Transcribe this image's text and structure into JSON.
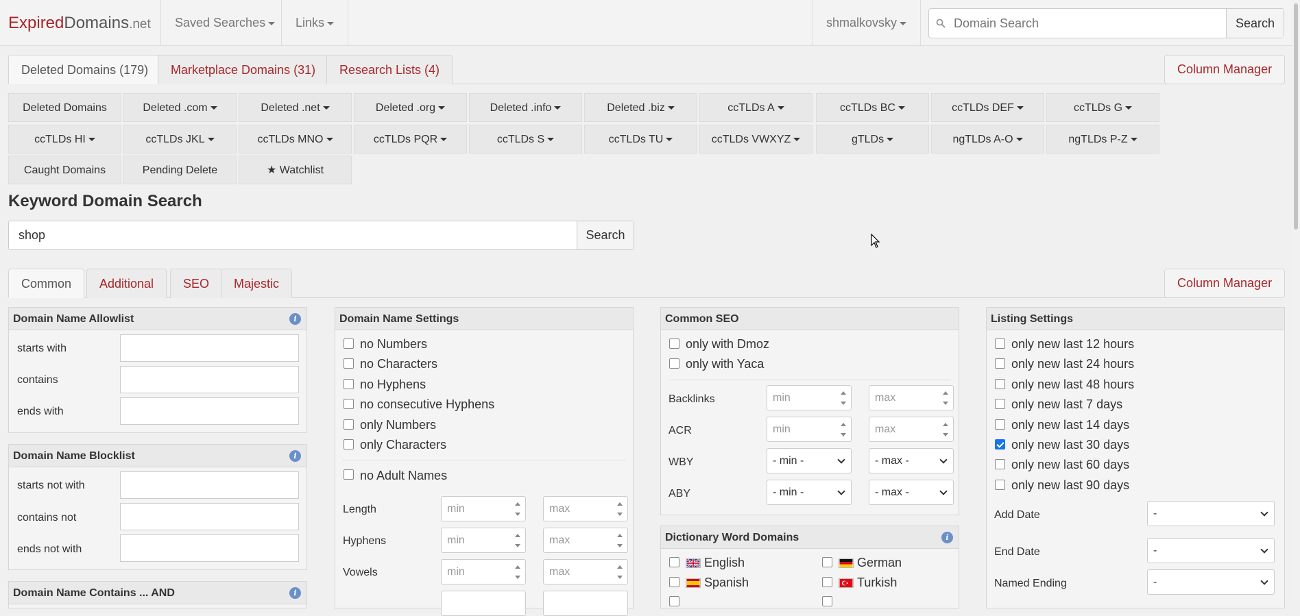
{
  "navbar": {
    "brand_main": "Expired",
    "brand_mid": "Domains",
    "brand_tld": ".net",
    "saved_searches": "Saved Searches",
    "links": "Links",
    "user": "shmalkovsky",
    "search_placeholder": "Domain Search",
    "search_button": "Search"
  },
  "tabs_top": [
    {
      "label": "Deleted Domains (179)"
    },
    {
      "label": "Marketplace Domains (31)"
    },
    {
      "label": "Research Lists (4)"
    }
  ],
  "column_manager": "Column Manager",
  "grid_buttons": [
    "Deleted Domains",
    "Deleted .com",
    "Deleted .net",
    "Deleted .org",
    "Deleted .info",
    "Deleted .biz",
    "ccTLDs A",
    "ccTLDs BC",
    "ccTLDs DEF",
    "ccTLDs G",
    "ccTLDs HI",
    "ccTLDs JKL",
    "ccTLDs MNO",
    "ccTLDs PQR",
    "ccTLDs S",
    "ccTLDs TU",
    "ccTLDs VWXYZ",
    "gTLDs",
    "ngTLDs A-O",
    "ngTLDs P-Z",
    "Caught Domains",
    "Pending Delete",
    "★ Watchlist"
  ],
  "keyword_search": {
    "heading": "Keyword Domain Search",
    "value": "shop",
    "button": "Search"
  },
  "tabs_filter": [
    {
      "label": "Common"
    },
    {
      "label": "Additional"
    },
    {
      "label": "SEO"
    },
    {
      "label": "Majestic"
    }
  ],
  "allowlist": {
    "title": "Domain Name Allowlist",
    "rows": [
      "starts with",
      "contains",
      "ends with"
    ]
  },
  "blocklist": {
    "title": "Domain Name Blocklist",
    "rows": [
      "starts not with",
      "contains not",
      "ends not with"
    ]
  },
  "contains_and": {
    "title": "Domain Name Contains ... AND"
  },
  "name_settings": {
    "title": "Domain Name Settings",
    "checks": [
      "no Numbers",
      "no Characters",
      "no Hyphens",
      "no consecutive Hyphens",
      "only Numbers",
      "only Characters"
    ],
    "adult": "no Adult Names",
    "ranges": [
      "Length",
      "Hyphens",
      "Vowels"
    ],
    "min": "min",
    "max": "max"
  },
  "common_seo": {
    "title": "Common SEO",
    "checks": [
      "only with Dmoz",
      "only with Yaca"
    ],
    "num_rows": [
      "Backlinks",
      "ACR"
    ],
    "sel_rows": [
      "WBY",
      "ABY"
    ],
    "min": "min",
    "max": "max",
    "sel_min": "- min -",
    "sel_max": "- max -"
  },
  "dictionary": {
    "title": "Dictionary Word Domains",
    "langs": [
      "English",
      "German",
      "Spanish",
      "Turkish"
    ]
  },
  "listing": {
    "title": "Listing Settings",
    "checks": [
      {
        "label": "only new last 12 hours",
        "checked": false
      },
      {
        "label": "only new last 24 hours",
        "checked": false
      },
      {
        "label": "only new last 48 hours",
        "checked": false
      },
      {
        "label": "only new last 7 days",
        "checked": false
      },
      {
        "label": "only new last 14 days",
        "checked": false
      },
      {
        "label": "only new last 30 days",
        "checked": true
      },
      {
        "label": "only new last 60 days",
        "checked": false
      },
      {
        "label": "only new last 90 days",
        "checked": false
      }
    ],
    "selects": [
      {
        "label": "Add Date",
        "value": "-"
      },
      {
        "label": "End Date",
        "value": "-"
      },
      {
        "label": "Named Ending",
        "value": "-"
      }
    ]
  },
  "colors": {
    "brand_red": "#a8262a",
    "checkbox_blue": "#1a73e8",
    "info_blue": "#6b8fc9"
  }
}
